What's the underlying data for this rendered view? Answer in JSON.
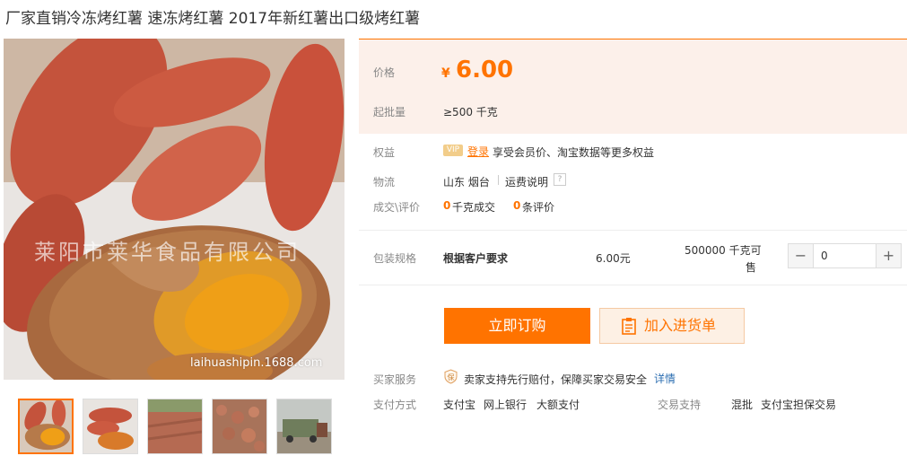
{
  "title": "厂家直销冷冻烤红薯 速冻烤红薯 2017年新红薯出口级烤红薯",
  "image": {
    "watermark": "莱阳市莱华食品有限公司",
    "site": "laihuashipin.1688.com"
  },
  "price": {
    "label": "价格",
    "currency": "¥",
    "value": "6.00",
    "moq_label": "起批量",
    "moq_value": "≥500  千克"
  },
  "benefits": {
    "label": "权益",
    "vip": "VIP",
    "login": "登录",
    "text": "享受会员价、淘宝数据等更多权益"
  },
  "logistics": {
    "label": "物流",
    "location": "山东 烟台",
    "shipping_note": "运费说明",
    "help": "?"
  },
  "deals": {
    "label": "成交\\评价",
    "deal_count": "0",
    "deal_text": "千克成交",
    "review_count": "0",
    "review_text": "条评价"
  },
  "spec": {
    "label": "包装规格",
    "name": "根据客户要求",
    "price": "6.00元",
    "stock_line1": "500000 千克可",
    "stock_line2": "售",
    "quantity": "0",
    "minus": "−",
    "plus": "+"
  },
  "actions": {
    "buy": "立即订购",
    "cart": "加入进货单"
  },
  "service": {
    "label": "买家服务",
    "text": "卖家支持先行赔付，保障买家交易安全",
    "detail": "详情",
    "icon_char": "保"
  },
  "payment": {
    "label": "支付方式",
    "methods": [
      "支付宝",
      "网上银行",
      "大额支付"
    ],
    "trade_label": "交易支持",
    "trade_items": [
      "混批",
      "支付宝担保交易"
    ]
  },
  "colors": {
    "accent": "#ff7300",
    "price_bg": "#fcf0ea",
    "link": "#2d6fb2"
  }
}
